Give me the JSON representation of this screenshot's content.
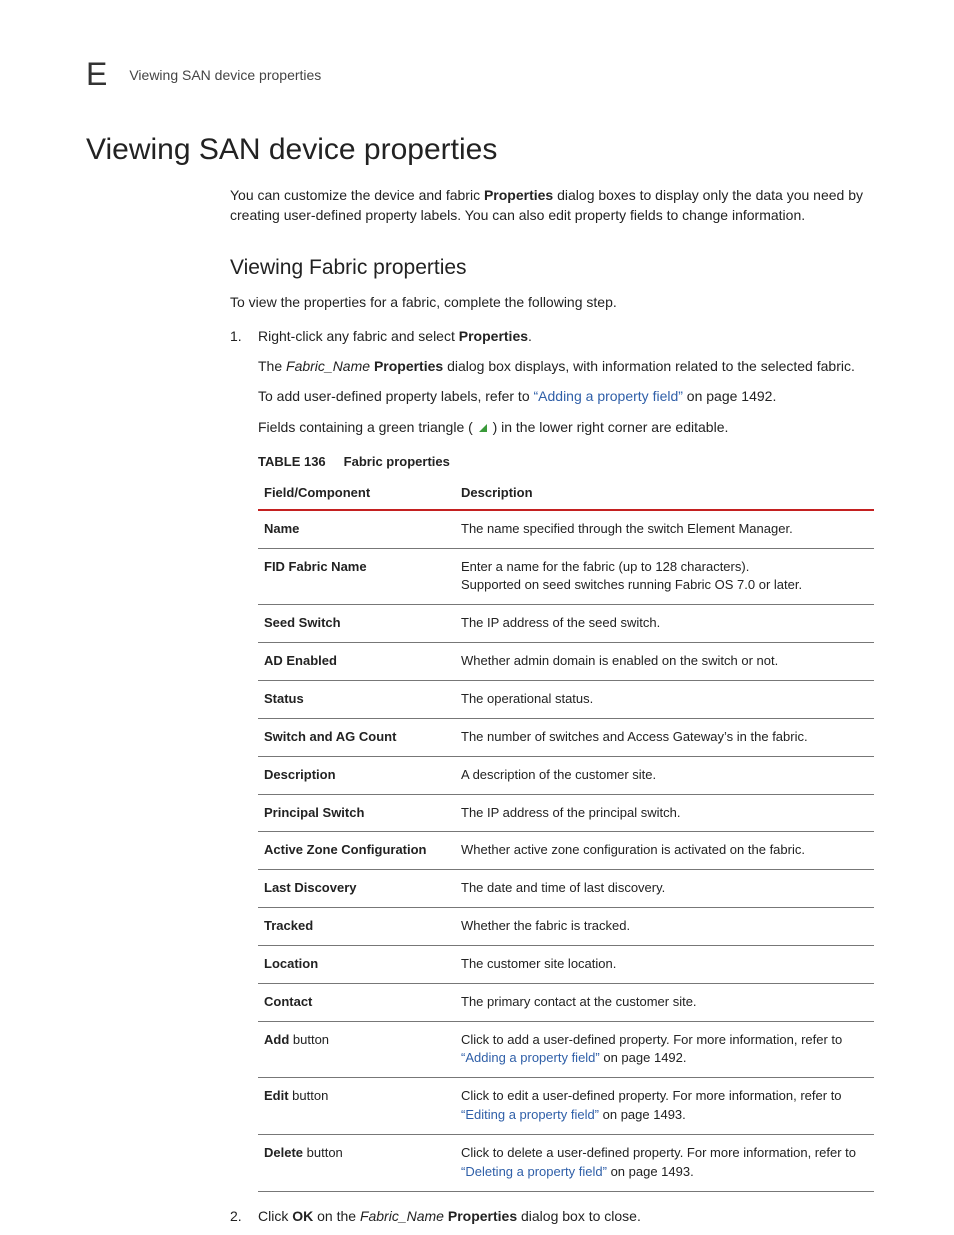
{
  "header": {
    "chapter": "E",
    "running": "Viewing SAN device properties"
  },
  "h1": "Viewing SAN device properties",
  "intro": {
    "p1a": "You can customize the device and fabric ",
    "p1b": "Properties",
    "p1c": " dialog boxes to display only the data you need by creating user-defined property labels. You can also edit property fields to change information."
  },
  "h2": "Viewing Fabric properties",
  "lead": "To view the properties for a fabric, complete the following step.",
  "step1": {
    "s1a": "Right-click any fabric and select ",
    "s1b": "Properties",
    "s1c": ".",
    "sub1a": "The ",
    "sub1b": "Fabric_Name",
    "sub1c": " ",
    "sub1d": "Properties",
    "sub1e": " dialog box displays, with information related to the selected fabric.",
    "sub2a": "To add user-defined property labels, refer to ",
    "sub2link": "“Adding a property field”",
    "sub2b": " on page 1492.",
    "sub3a": "Fields containing a green triangle (",
    "sub3b": ") in the lower right corner are editable."
  },
  "table": {
    "caption_num": "TABLE 136",
    "caption_title": "Fabric properties",
    "head": {
      "c1": "Field/Component",
      "c2": "Description"
    },
    "rows": [
      {
        "f": "Name",
        "d": "The name specified through the switch Element Manager."
      },
      {
        "f": "FID Fabric Name",
        "d": "Enter a name for the fabric (up to 128 characters).",
        "d2": "Supported on seed switches running Fabric OS 7.0 or later."
      },
      {
        "f": "Seed Switch",
        "d": "The IP address of the seed switch."
      },
      {
        "f": "AD Enabled",
        "d": "Whether admin domain is enabled on the switch or not."
      },
      {
        "f": "Status",
        "d": "The operational status."
      },
      {
        "f": "Switch and AG Count",
        "d": "The number of switches and Access Gateway’s in the fabric."
      },
      {
        "f": "Description",
        "d": "A description of the customer site."
      },
      {
        "f": "Principal Switch",
        "d": "The IP address of the principal switch."
      },
      {
        "f": "Active Zone Configuration",
        "d": "Whether active zone configuration is activated on the fabric."
      },
      {
        "f": "Last Discovery",
        "d": "The date and time of last discovery."
      },
      {
        "f": "Tracked",
        "d": "Whether the fabric is tracked."
      },
      {
        "f": "Location",
        "d": "The customer site location."
      },
      {
        "f": "Contact",
        "d": "The primary contact at the customer site."
      },
      {
        "f": "Add",
        "fsuf": " button",
        "d_pre": "Click to add a user-defined property. For more information, refer to ",
        "link": "“Adding a property field”",
        "d_post": " on page 1492."
      },
      {
        "f": "Edit",
        "fsuf": " button",
        "d_pre": "Click to edit a user-defined property. For more information, refer to ",
        "link": "“Editing a property field”",
        "d_post": " on page 1493."
      },
      {
        "f": "Delete",
        "fsuf": " button",
        "d_pre": "Click to delete a user-defined property. For more information, refer to ",
        "link": "“Deleting a property field”",
        "d_post": " on page 1493."
      }
    ]
  },
  "step2": {
    "a": "Click ",
    "b": "OK",
    "c": " on the ",
    "d": "Fabric_Name",
    "e": " ",
    "f": "Properties",
    "g": " dialog box to close."
  }
}
